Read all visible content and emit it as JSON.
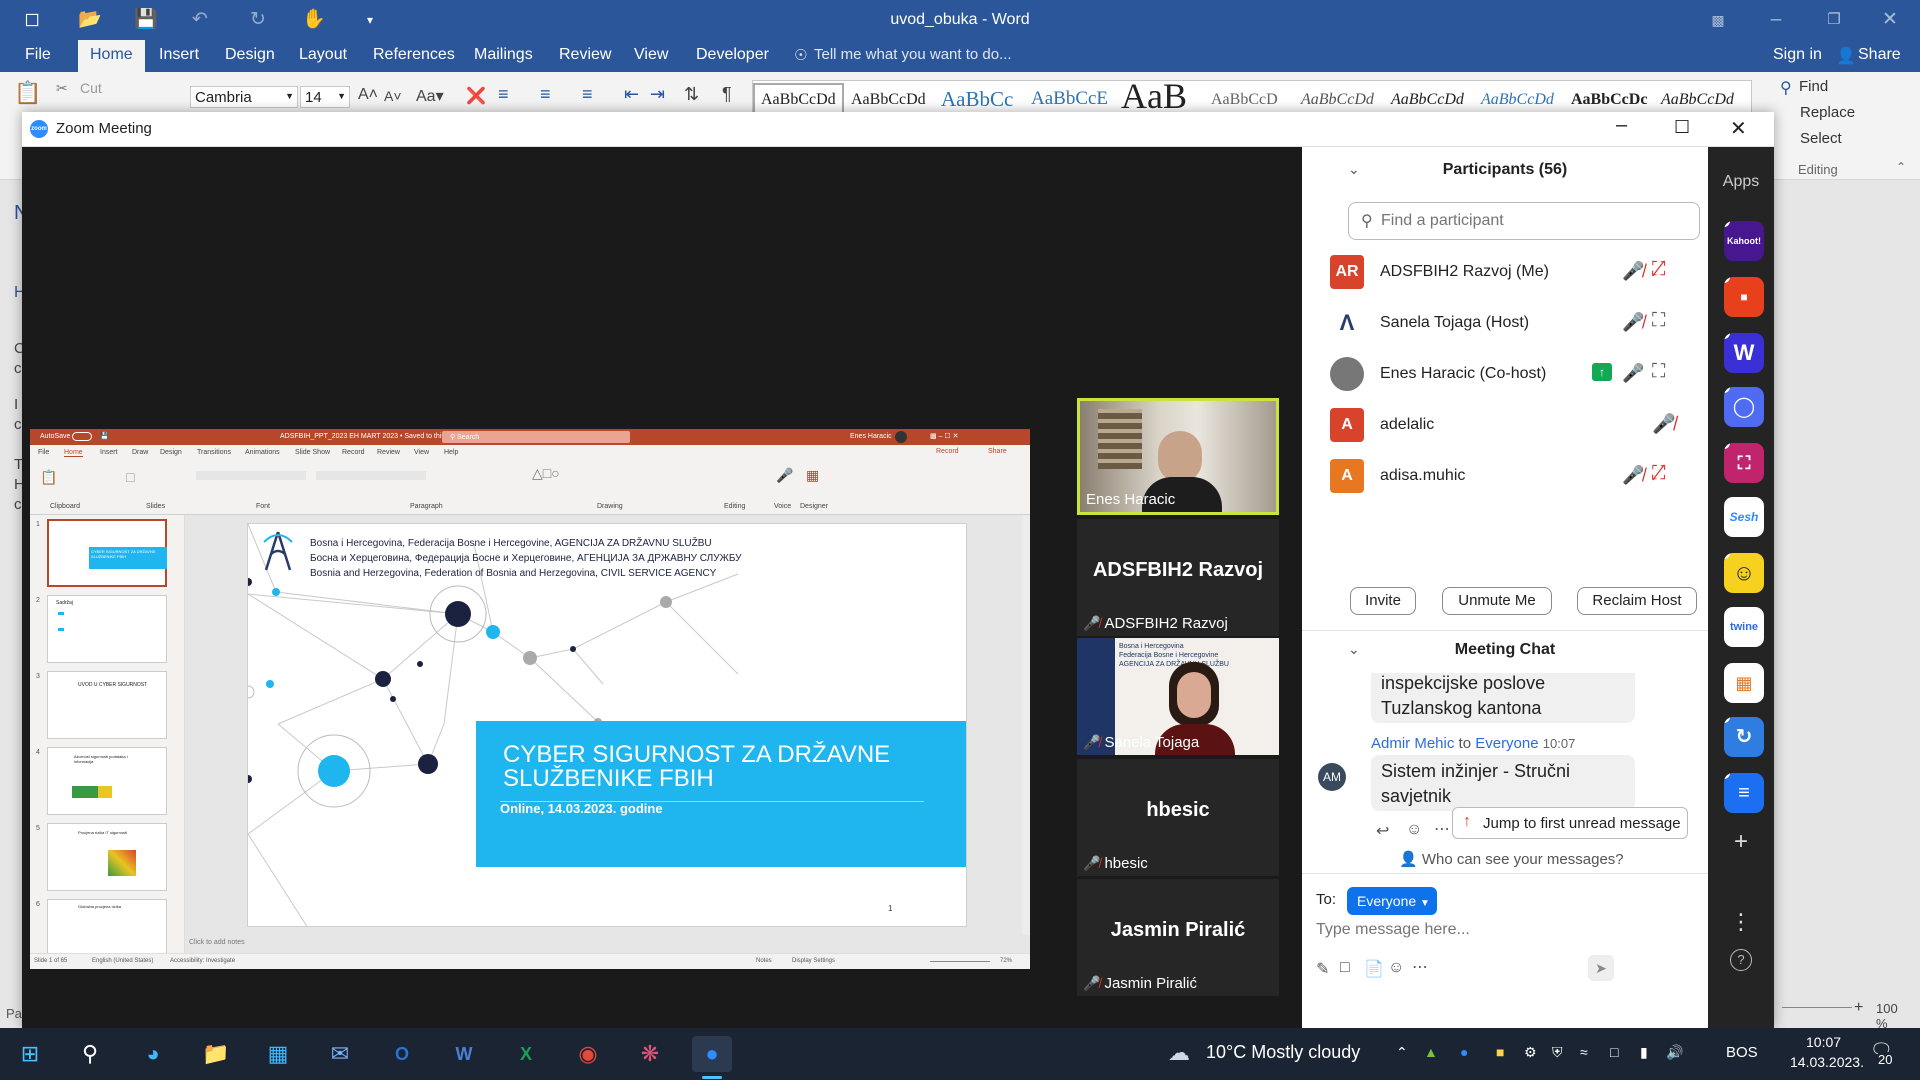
{
  "word": {
    "title": "uvod_obuka - Word",
    "tabs": [
      "File",
      "Home",
      "Insert",
      "Design",
      "Layout",
      "References",
      "Mailings",
      "Review",
      "View",
      "Developer"
    ],
    "tell_me": "Tell me what you want to do...",
    "sign_in": "Sign in",
    "share": "Share",
    "cut": "Cut",
    "font_name": "Cambria",
    "font_size": "14",
    "styles": [
      "AaBbCcDd",
      "AaBbCcDd",
      "AaBbCc",
      "AaBbCcE",
      "AaB",
      "AaBbCcD",
      "AaBbCcDd",
      "AaBbCcDd",
      "AaBbCcDd",
      "AaBbCcDc",
      "AaBbCcDd"
    ],
    "find": "Find",
    "replace": "Replace",
    "select": "Select",
    "editing": "Editing",
    "zoom_level": "100 %",
    "left_edge": {
      "pa": "Pa",
      "n": "N",
      "h": "H",
      "c1": "C",
      "c2": "c",
      "i1": "I",
      "c3": "c",
      "t": "T",
      "h2": "H",
      "c4": "c"
    }
  },
  "zoom": {
    "window_title": "Zoom Meeting",
    "participants_title": "Participants (56)",
    "search_placeholder": "Find a participant",
    "participants": [
      {
        "initials": "AR",
        "name": "ADSFBIH2 Razvoj (Me)",
        "color": "#d8432b"
      },
      {
        "initials": "",
        "name": "Sanela Tojaga (Host)",
        "color": "#ffffff"
      },
      {
        "initials": "",
        "name": "Enes Haracic (Co-host)",
        "color": "#555555"
      },
      {
        "initials": "A",
        "name": "adelalic",
        "color": "#d8432b"
      },
      {
        "initials": "A",
        "name": "adisa.muhic",
        "color": "#e87722"
      }
    ],
    "buttons": {
      "invite": "Invite",
      "unmute": "Unmute Me",
      "reclaim": "Reclaim Host"
    },
    "chat_title": "Meeting Chat",
    "chat_prev": "inspekcijske poslove\nTuzlanskog kantona",
    "chat_sender": "Admir Mehic",
    "chat_to_word": "to",
    "chat_recipient": "Everyone",
    "chat_time": "10:07",
    "chat_initials": "AM",
    "chat_message": "Sistem inžinjer - Stručni\nsavjetnik",
    "jump": "Jump to first unread message",
    "who_can_see": "Who can see your messages?",
    "to_label": "To:",
    "to_value": "Everyone",
    "message_placeholder": "Type message here...",
    "apps_label": "Apps",
    "tiles": [
      {
        "name": "Enes Haracic",
        "big": ""
      },
      {
        "name": "ADSFBIH2 Razvoj",
        "big": "ADSFBIH2 Razvoj"
      },
      {
        "name": "Sanela Tojaga",
        "big": ""
      },
      {
        "name": "hbesic",
        "big": "hbesic"
      },
      {
        "name": "Jasmin Piralić",
        "big": "Jasmin Piralić"
      }
    ],
    "apps": [
      {
        "label": "Kahoot!",
        "color": "#46178f"
      },
      {
        "label": "",
        "color": "#e8401c"
      },
      {
        "label": "W",
        "color": "#3b2fd6"
      },
      {
        "label": "",
        "color": "#4f6bf2"
      },
      {
        "label": "",
        "color": "#c0246c"
      },
      {
        "label": "Sesh",
        "color": "#ffffff"
      },
      {
        "label": "",
        "color": "#f6d21f"
      },
      {
        "label": "twine",
        "color": "#ffffff"
      },
      {
        "label": "",
        "color": "#ffffff"
      },
      {
        "label": "",
        "color": "#2f7de1"
      },
      {
        "label": "",
        "color": "#1b6ff0"
      }
    ]
  },
  "ppt": {
    "title": "ADSFBIH_PPT_2023 EH MART 2023 • Saved to this PC",
    "user": "Enes Haracic",
    "search": "Search",
    "record": "Record",
    "share": "Share",
    "autosave": "AutoSave",
    "tabs": [
      "File",
      "Home",
      "Insert",
      "Draw",
      "Design",
      "Transitions",
      "Animations",
      "Slide Show",
      "Record",
      "Review",
      "View",
      "Help"
    ],
    "groups": [
      "Clipboard",
      "Slides",
      "Font",
      "Paragraph",
      "Drawing",
      "Editing",
      "Voice",
      "Designer"
    ],
    "header_lines": [
      "Bosna i Hercegovina, Federacija Bosne i Hercegovine, AGENCIJA ZA DRŽAVNU SLUŽBU",
      "Босна и Херцеговина, Федерација Босне и Херцеговине, АГЕНЦИЈА ЗА ДРЖАВНУ СЛУЖБУ",
      "Bosnia and Herzegovina, Federation of Bosnia and Herzegovina, CIVIL SERVICE AGENCY"
    ],
    "slide_title": "CYBER SIGURNOST ZA DRŽAVNE SLUŽBENIKE FBIH",
    "slide_subtitle": "Online, 14.03.2023. godine",
    "slide_number": "1",
    "notes": "Click to add notes",
    "status_left": "Slide 1 of 65",
    "status_lang": "English (United States)",
    "status_access": "Accessibility: Investigate",
    "status_notes": "Notes",
    "status_display": "Display Settings",
    "status_zoom": "72%",
    "thumb_titles": [
      "CYBER SIGURNOST ZA DRŽAVNE SLUŽBENIKE FBIH",
      "Sadržaj",
      "UVOD U CYBER SIGURNOST",
      "Ažurnost sigurnosti podataka i informacija",
      "Procjena rizika IT sigurnosti",
      "Globalna procjena rizika"
    ]
  },
  "taskbar": {
    "weather": "10°C  Mostly cloudy",
    "lang": "BOS",
    "time": "10:07",
    "date": "14.03.2023.",
    "notifications": "20"
  }
}
